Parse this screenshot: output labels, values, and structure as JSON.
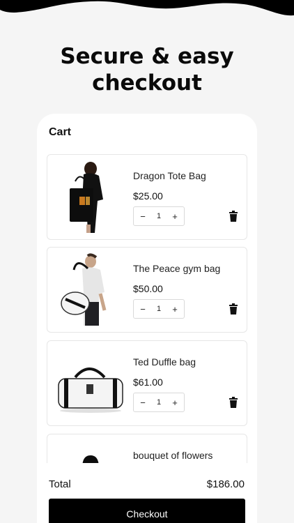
{
  "headline": {
    "line1": "Secure & easy",
    "line2": "checkout"
  },
  "cart": {
    "title": "Cart",
    "items": [
      {
        "name": "Dragon Tote Bag",
        "price": "$25.00",
        "quantity": "1",
        "image": "black tote bag held by person"
      },
      {
        "name": "The Peace gym bag",
        "price": "$50.00",
        "quantity": "1",
        "image": "white gym bag held by man"
      },
      {
        "name": "Ted Duffle bag",
        "price": "$61.00",
        "quantity": "1",
        "image": "white duffle bag"
      },
      {
        "name": "bouquet of flowers Hoodie",
        "price": "",
        "quantity": "",
        "image": "black hoodie"
      }
    ],
    "minus_symbol": "−",
    "plus_symbol": "+"
  },
  "summary": {
    "total_label": "Total",
    "total_value": "$186.00"
  },
  "checkout": {
    "label": "Checkout"
  },
  "colors": {
    "background": "#f5f5f5",
    "panel": "#ffffff",
    "button": "#000000",
    "text": "#111111"
  }
}
